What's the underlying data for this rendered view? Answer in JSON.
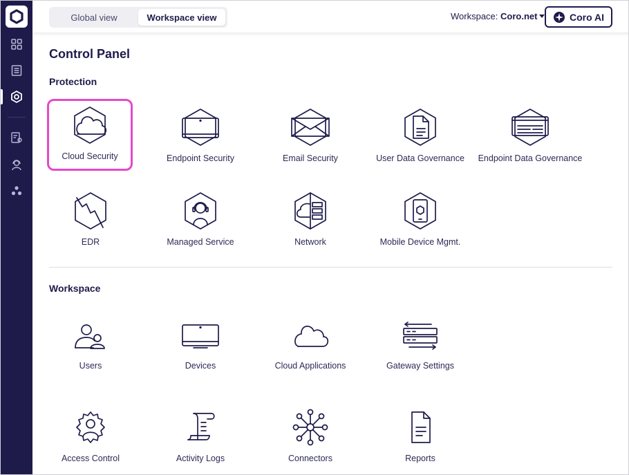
{
  "header": {
    "toggle": {
      "global_label": "Global view",
      "workspace_label": "Workspace view"
    },
    "workspace_prefix": "Workspace:",
    "workspace_name": "Coro.net",
    "ai_button_label": "Coro AI"
  },
  "sidebar": {
    "items": [
      {
        "icon": "dashboard-icon"
      },
      {
        "icon": "tickets-icon"
      },
      {
        "icon": "control-panel-icon",
        "active": true
      },
      {
        "icon": "settings-report-icon"
      },
      {
        "icon": "user-support-icon"
      },
      {
        "icon": "network-nodes-icon"
      }
    ]
  },
  "main": {
    "title": "Control Panel",
    "protection": {
      "title": "Protection",
      "tiles": [
        {
          "label": "Cloud Security",
          "icon": "cloud-hex-icon",
          "selected": true
        },
        {
          "label": "Endpoint Security",
          "icon": "laptop-hex-icon"
        },
        {
          "label": "Email Security",
          "icon": "envelope-hex-icon"
        },
        {
          "label": "User Data Governance",
          "icon": "document-hex-icon"
        },
        {
          "label": "Endpoint Data Governance",
          "icon": "screen-hex-icon"
        },
        {
          "label": "EDR",
          "icon": "edr-hex-icon"
        },
        {
          "label": "Managed Service",
          "icon": "headset-hex-icon"
        },
        {
          "label": "Network",
          "icon": "network-hex-icon"
        },
        {
          "label": "Mobile Device Mgmt.",
          "icon": "mobile-hex-icon"
        }
      ]
    },
    "workspace": {
      "title": "Workspace",
      "tiles": [
        {
          "label": "Users",
          "icon": "users-icon"
        },
        {
          "label": "Devices",
          "icon": "monitor-icon"
        },
        {
          "label": "Cloud Applications",
          "icon": "cloud-icon"
        },
        {
          "label": "Gateway Settings",
          "icon": "gateway-servers-icon"
        },
        {
          "label": "Access Control",
          "icon": "access-control-icon"
        },
        {
          "label": "Activity Logs",
          "icon": "scroll-log-icon"
        },
        {
          "label": "Connectors",
          "icon": "connectors-icon"
        },
        {
          "label": "Reports",
          "icon": "report-document-icon"
        }
      ]
    }
  }
}
